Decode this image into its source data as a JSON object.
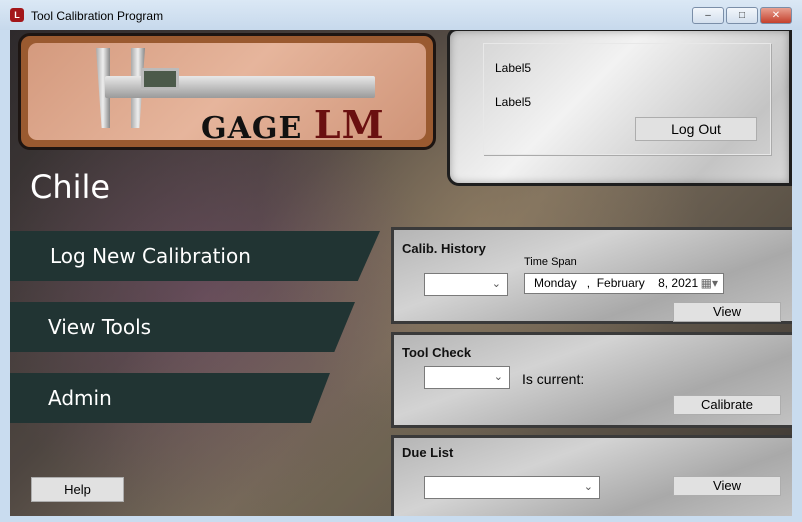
{
  "window": {
    "title": "Tool Calibration Program",
    "minimize": "–",
    "maximize": "□",
    "close": "✕"
  },
  "logo": {
    "brand": "GAGE",
    "brand_accent": "LM"
  },
  "user_panel": {
    "label1": "Label5",
    "label2": "Label5",
    "logout": "Log Out"
  },
  "location": "Chile",
  "nav": [
    {
      "label": "Log New Calibration"
    },
    {
      "label": "View Tools"
    },
    {
      "label": "Admin"
    }
  ],
  "help": "Help",
  "calib_history": {
    "title": "Calib. History",
    "combo_value": "",
    "time_span_label": "Time Span",
    "date": {
      "weekday": "Monday",
      "month": "February",
      "day_year": "8, 2021"
    },
    "view": "View"
  },
  "tool_check": {
    "title": "Tool Check",
    "combo_value": "",
    "is_current_label": "Is current:",
    "calibrate": "Calibrate"
  },
  "due_list": {
    "title": "Due List",
    "combo_value": "",
    "view": "View"
  },
  "colors": {
    "nav_bg": "#213433",
    "accent": "#6a1010"
  }
}
